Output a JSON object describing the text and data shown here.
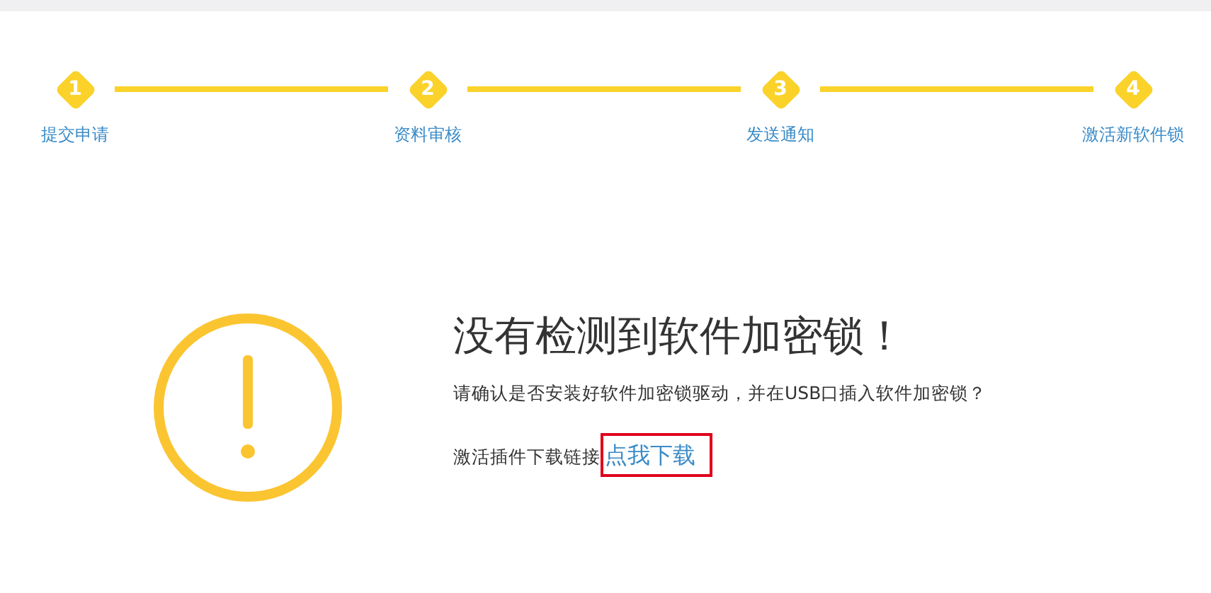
{
  "steps": [
    {
      "number": "1",
      "label": "提交申请"
    },
    {
      "number": "2",
      "label": "资料审核"
    },
    {
      "number": "3",
      "label": "发送通知"
    },
    {
      "number": "4",
      "label": "激活新软件锁"
    }
  ],
  "message": {
    "title": "没有检测到软件加密锁！",
    "text": "请确认是否安装好软件加密锁驱动，并在USB口插入软件加密锁？",
    "link_prefix": "激活插件下载链接",
    "link": {
      "label": "点我下载",
      "highlighted": true
    }
  }
}
